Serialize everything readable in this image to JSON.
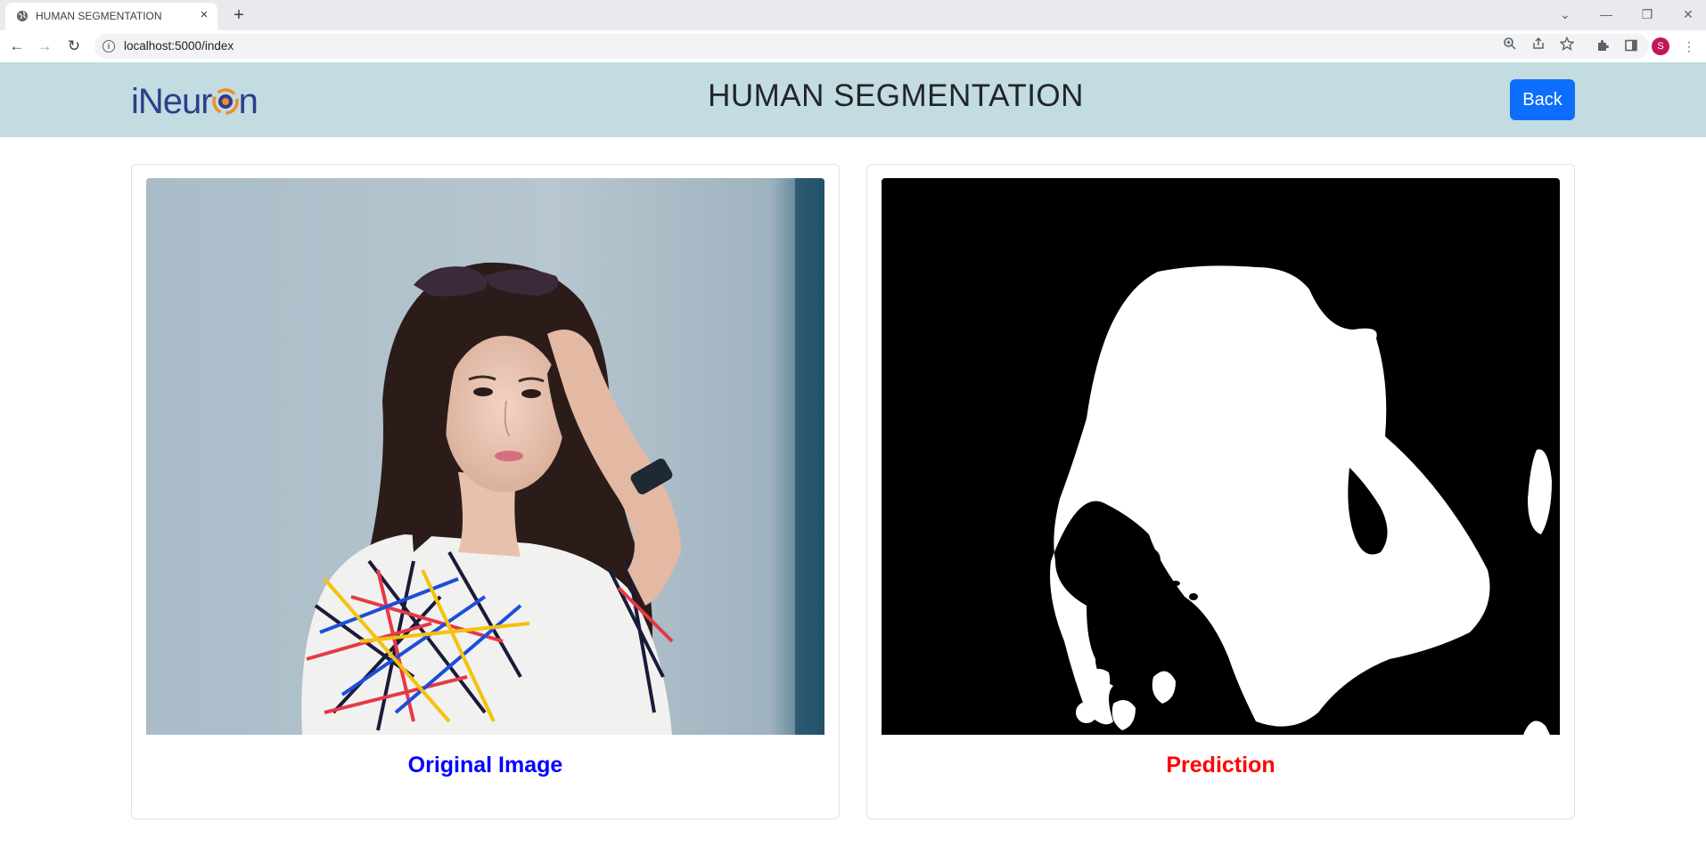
{
  "browser": {
    "tab_title": "HUMAN SEGMENTATION",
    "tab_close": "×",
    "new_tab": "+",
    "url": "localhost:5000/index",
    "profile_initial": "S",
    "icons": [
      "globe-icon",
      "back-arrow-icon",
      "forward-arrow-icon",
      "reload-icon",
      "info-icon",
      "zoom-icon",
      "share-icon",
      "star-icon",
      "extensions-icon",
      "side-panel-icon",
      "menu-icon"
    ]
  },
  "header": {
    "logo_text_prefix": "iNeur",
    "logo_text_suffix": "n",
    "title": "HUMAN SEGMENTATION",
    "back_label": "Back",
    "background_color": "#c2dce1",
    "button_color": "#0d6efd"
  },
  "cards": {
    "original": {
      "caption": "Original Image",
      "caption_color": "#0000ff"
    },
    "prediction": {
      "caption": "Prediction",
      "caption_color": "#ff0000"
    }
  }
}
